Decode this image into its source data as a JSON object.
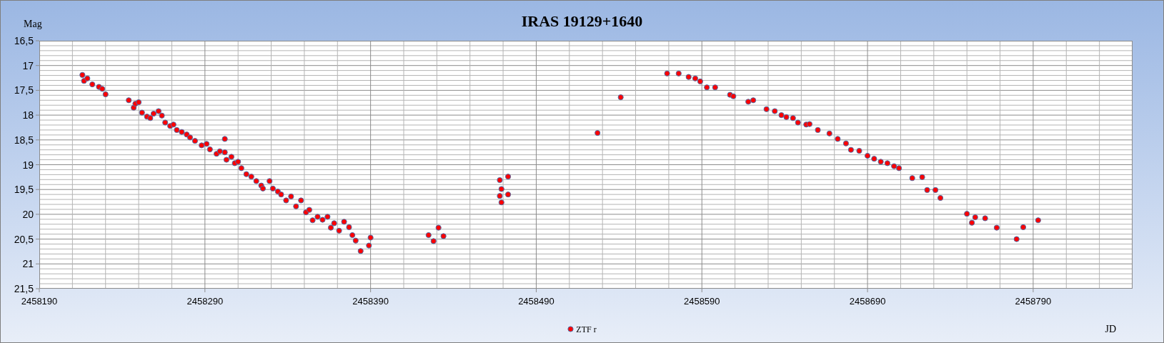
{
  "chart": {
    "chart_data": {
      "type": "scatter",
      "title": "IRAS 19129+1640",
      "xlabel": "JD",
      "ylabel": "Mag",
      "grid": true,
      "xlim": [
        2458190,
        2458850
      ],
      "ylim": [
        21.5,
        16.5
      ],
      "xticks": [
        2458190,
        2458290,
        2458390,
        2458490,
        2458590,
        2458690,
        2458790
      ],
      "yticks": [
        {
          "value": 16.5,
          "label": "16,5"
        },
        {
          "value": 17,
          "label": "17"
        },
        {
          "value": 17.5,
          "label": "17,5"
        },
        {
          "value": 18,
          "label": "18"
        },
        {
          "value": 18.5,
          "label": "18,5"
        },
        {
          "value": 19,
          "label": "19"
        },
        {
          "value": 19.5,
          "label": "19,5"
        },
        {
          "value": 20,
          "label": "20"
        },
        {
          "value": 20.5,
          "label": "20,5"
        },
        {
          "value": 21,
          "label": "21"
        },
        {
          "value": 21.5,
          "label": "21,5"
        }
      ],
      "x": [
        2458216,
        2458217,
        2458219,
        2458222,
        2458226,
        2458228,
        2458230,
        2458244,
        2458247,
        2458248,
        2458250,
        2458252,
        2458255,
        2458257,
        2458259,
        2458262,
        2458264,
        2458266,
        2458269,
        2458271,
        2458273,
        2458276,
        2458279,
        2458281,
        2458284,
        2458288,
        2458291,
        2458293,
        2458297,
        2458299,
        2458302,
        2458302,
        2458303,
        2458306,
        2458308,
        2458310,
        2458312,
        2458315,
        2458318,
        2458321,
        2458324,
        2458325,
        2458329,
        2458331,
        2458334,
        2458336,
        2458339,
        2458342,
        2458345,
        2458348,
        2458351,
        2458353,
        2458355,
        2458358,
        2458361,
        2458364,
        2458366,
        2458368,
        2458371,
        2458374,
        2458377,
        2458379,
        2458381,
        2458384,
        2458389,
        2458390,
        2458425,
        2458428,
        2458431,
        2458434,
        2458468,
        2458468,
        2458469,
        2458469,
        2458473,
        2458473,
        2458527,
        2458541,
        2458569,
        2458576,
        2458582,
        2458586,
        2458589,
        2458593,
        2458598,
        2458607,
        2458609,
        2458618,
        2458621,
        2458629,
        2458634,
        2458638,
        2458641,
        2458645,
        2458648,
        2458653,
        2458655,
        2458660,
        2458667,
        2458672,
        2458677,
        2458680,
        2458685,
        2458690,
        2458694,
        2458698,
        2458702,
        2458706,
        2458709,
        2458717,
        2458723,
        2458726,
        2458731,
        2458734,
        2458750,
        2458753,
        2458755,
        2458761,
        2458768,
        2458780,
        2458784,
        2458793
      ],
      "series": [
        {
          "name": "ZTF r",
          "color": "#ff0000",
          "values": [
            17.19,
            17.31,
            17.26,
            17.38,
            17.43,
            17.47,
            17.58,
            17.7,
            17.85,
            17.77,
            17.74,
            17.95,
            18.03,
            18.06,
            17.97,
            17.92,
            18.01,
            18.15,
            18.22,
            18.19,
            18.3,
            18.34,
            18.39,
            18.45,
            18.52,
            18.61,
            18.58,
            18.69,
            18.78,
            18.73,
            18.75,
            18.48,
            18.9,
            18.84,
            18.97,
            18.94,
            19.07,
            19.19,
            19.24,
            19.33,
            19.42,
            19.48,
            19.33,
            19.48,
            19.54,
            19.6,
            19.72,
            19.64,
            19.84,
            19.72,
            19.96,
            19.91,
            20.12,
            20.05,
            20.11,
            20.05,
            20.27,
            20.18,
            20.33,
            20.15,
            20.26,
            20.42,
            20.53,
            20.74,
            20.63,
            20.47,
            20.42,
            20.54,
            20.27,
            20.44,
            19.31,
            19.63,
            19.49,
            19.76,
            19.24,
            19.6,
            18.36,
            17.64,
            17.16,
            17.16,
            17.23,
            17.26,
            17.32,
            17.44,
            17.44,
            17.59,
            17.62,
            17.73,
            17.7,
            17.88,
            17.92,
            18.0,
            18.04,
            18.06,
            18.15,
            18.19,
            18.18,
            18.3,
            18.37,
            18.48,
            18.57,
            18.7,
            18.72,
            18.82,
            18.88,
            18.94,
            18.97,
            19.03,
            19.07,
            19.27,
            19.25,
            19.51,
            19.51,
            19.67,
            19.99,
            20.17,
            20.06,
            20.08,
            20.27,
            20.5,
            20.26,
            20.12
          ]
        }
      ]
    }
  }
}
